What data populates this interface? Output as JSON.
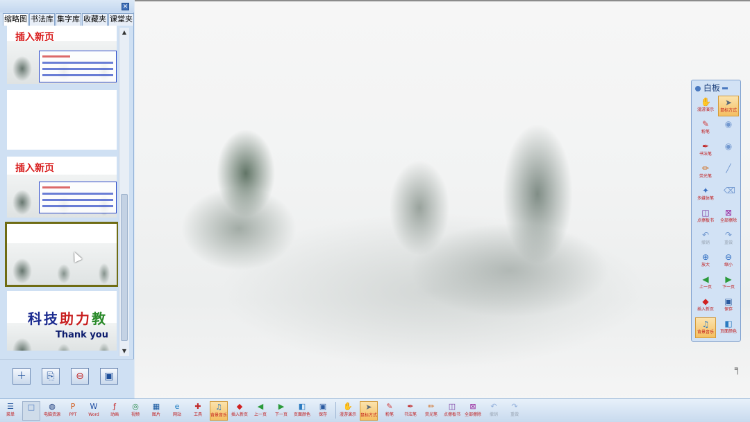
{
  "panel": {
    "close_glyph": "✕",
    "tabs": [
      "缩略图",
      "书法库",
      "集字库",
      "收藏夹",
      "课堂夹"
    ],
    "active_tab": 0,
    "slides": [
      {
        "title": "插入新页",
        "lines": [
          "插入新页的三种方式。",
          "第一种方式：从菜单插入新页。",
          "第二种方式：从缩略图插入新页。",
          "第三种方式：从快捷键插入新页。"
        ]
      },
      {
        "title": "",
        "lines": []
      },
      {
        "title": "插入新页",
        "lines": [
          "插入新页的三种方式。",
          "第一种方式：从菜单插入新页。",
          "第二种方式：从缩略图插入新页。",
          "第三种方式：从快捷键插入新页。"
        ]
      },
      {
        "title": "",
        "lines": [],
        "selected": true
      },
      {
        "big_text": "科技助力教",
        "thank_text": "Thank  you"
      }
    ],
    "bottom_buttons": [
      "add-page",
      "copy-page",
      "delete-page",
      "save-page"
    ]
  },
  "whiteboard": {
    "title": "白板",
    "buttons": [
      [
        "漫游演示",
        "hand-icon",
        false,
        false
      ],
      [
        "鼠标方式",
        "arrow-icon",
        false,
        true
      ],
      [
        "粉笔",
        "chalk-icon",
        false,
        false
      ],
      [
        "",
        "disc-icon",
        true,
        false
      ],
      [
        "书法笔",
        "brush-icon",
        false,
        false
      ],
      [
        "",
        "disc-icon",
        true,
        false
      ],
      [
        "荧光笔",
        "highlighter-icon",
        false,
        false
      ],
      [
        "",
        "pen-icon",
        true,
        false
      ],
      [
        "多媒体笔",
        "magic-pen-icon",
        false,
        false
      ],
      [
        "",
        "eraser-icon",
        true,
        false
      ],
      [
        "点擦板书",
        "point-erase-icon",
        false,
        false
      ],
      [
        "全部擦除",
        "clear-all-icon",
        false,
        false
      ],
      [
        "撤销",
        "undo-icon",
        true,
        false
      ],
      [
        "重做",
        "redo-icon",
        true,
        false
      ],
      [
        "放大",
        "zoom-in-icon",
        false,
        false
      ],
      [
        "缩小",
        "zoom-out-icon",
        false,
        false
      ],
      [
        "上一页",
        "prev-page-icon",
        false,
        false
      ],
      [
        "下一页",
        "next-page-icon",
        false,
        false
      ],
      [
        "插入新页",
        "insert-page-icon",
        false,
        false
      ],
      [
        "保存",
        "save-icon",
        false,
        false
      ],
      [
        "背景音乐",
        "music-icon",
        false,
        true
      ],
      [
        "页面颜色",
        "color-icon",
        false,
        false
      ]
    ]
  },
  "toolbar": {
    "buttons": [
      [
        "菜单",
        "menu-icon",
        "normal"
      ],
      [
        "",
        "blank-icon",
        "sel"
      ],
      [
        "电脑资源",
        "globe-icon",
        "normal"
      ],
      [
        "PPT",
        "ppt-icon",
        "normal"
      ],
      [
        "Word",
        "word-icon",
        "normal"
      ],
      [
        "动画",
        "flash-icon",
        "normal"
      ],
      [
        "视频",
        "video-icon",
        "normal"
      ],
      [
        "图片",
        "image-icon",
        "normal"
      ],
      [
        "网站",
        "ie-icon",
        "normal"
      ],
      [
        "工具",
        "tools-icon",
        "normal"
      ],
      [
        "背景音乐",
        "music-icon",
        "hl"
      ],
      [
        "插入新页",
        "insert-page-icon",
        "normal"
      ],
      [
        "上一页",
        "prev-page-icon",
        "normal"
      ],
      [
        "下一页",
        "next-page-icon",
        "normal"
      ],
      [
        "页面颜色",
        "color-icon",
        "normal"
      ],
      [
        "保存",
        "save-icon",
        "normal"
      ],
      [
        "漫游演示",
        "hand-icon",
        "normal"
      ],
      [
        "鼠标方式",
        "arrow-icon",
        "hl"
      ],
      [
        "粉笔",
        "chalk-icon",
        "normal"
      ],
      [
        "书法笔",
        "brush-icon",
        "normal"
      ],
      [
        "荧光笔",
        "highlighter-icon",
        "normal"
      ],
      [
        "点擦板书",
        "point-erase-icon",
        "normal"
      ],
      [
        "全部擦除",
        "clear-all-icon",
        "normal"
      ],
      [
        "撤销",
        "undo-icon",
        "dim"
      ],
      [
        "重做",
        "redo-icon",
        "dim"
      ]
    ]
  },
  "colors": {
    "accent": "#4a79c0",
    "label_red": "#c01818",
    "selected_border": "#6f6c14"
  }
}
